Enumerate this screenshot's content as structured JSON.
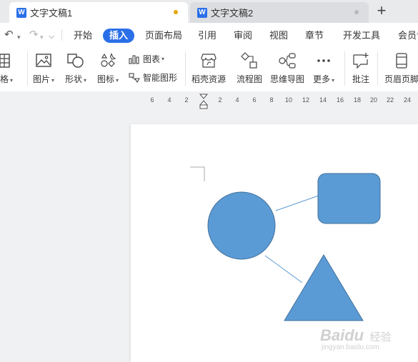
{
  "tabs": [
    {
      "label": "文字文稿1",
      "doc_icon": "W",
      "active": true
    },
    {
      "label": "文字文稿2",
      "doc_icon": "W",
      "active": false
    }
  ],
  "new_tab_icon": "+",
  "quick_access": {
    "undo": "↶",
    "redo": "↷",
    "caret": "▾",
    "customize": "⌵"
  },
  "menu": [
    "开始",
    "插入",
    "页面布局",
    "引用",
    "审阅",
    "视图",
    "章节",
    "开发工具",
    "会员专"
  ],
  "menu_active": "插入",
  "accent_color": "#2b6fe8",
  "ribbon": {
    "table": "表格",
    "picture": "图片",
    "shape": "形状",
    "icon": "图标",
    "chart": "图表",
    "smart_art": "智能图形",
    "resources": "稻壳资源",
    "flowchart": "流程图",
    "mindmap": "思维导图",
    "more": "更多",
    "comment": "批注",
    "header_footer": "页眉页脚",
    "caret": "▾"
  },
  "ruler_ticks": [
    "6",
    "4",
    "2",
    "2",
    "4",
    "6",
    "8",
    "10",
    "12",
    "14",
    "16",
    "18",
    "20",
    "22",
    "24"
  ],
  "shapes": {
    "fill": "#5b9bd5",
    "stroke": "#41719c",
    "connector": "#5b9bd5"
  },
  "watermark": {
    "brand": "Baidu",
    "brand_cn": "经验",
    "url": "jingyan.baidu.com"
  }
}
